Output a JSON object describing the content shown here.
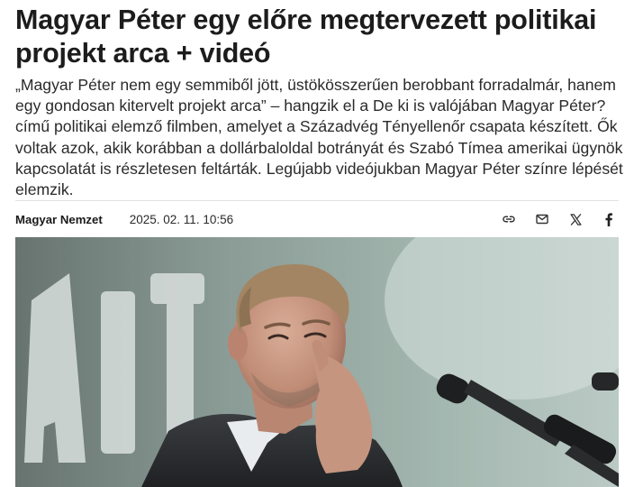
{
  "article": {
    "title": "Magyar Péter egy előre megtervezett politikai projekt arca + videó",
    "lead": "„Magyar Péter nem egy semmiből jött, üstökösszerűen berobbant forradalmár, hanem egy gondosan kitervelt projekt arca” – hangzik el a De ki is valójában Magyar Péter? című politikai elemző filmben, amelyet a Századvég Tényellenőr csapata készített. Ők voltak azok, akik korábban a dollárbaloldal botrányát és Szabó Tímea amerikai ügynök kapcsolatát is részletesen feltárták. Legújabb videójukban Magyar Péter színre lépését elemzik.",
    "author": "Magyar Nemzet",
    "date": "2025. 02. 11. 10:56"
  },
  "share": {
    "icons": [
      "link-icon",
      "mail-icon",
      "x-icon",
      "facebook-icon"
    ]
  },
  "photo": {
    "background_sign_letters": "ÁRT",
    "colors": {
      "background": "#8fa39c",
      "sign": "#e8ecea",
      "jacket": "#2f3234",
      "skin": "#c99a86",
      "hair": "#a88a6a",
      "microphone": "#1e1f20"
    }
  }
}
